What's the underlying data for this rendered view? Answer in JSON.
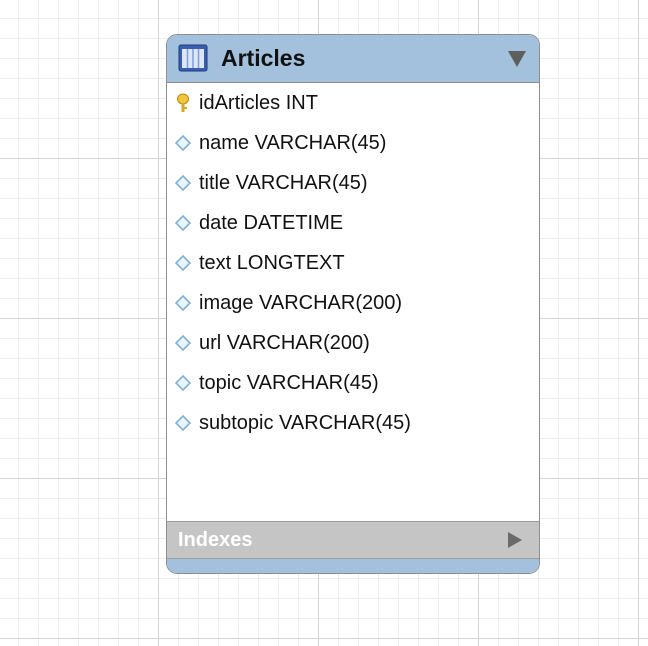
{
  "table": {
    "title": "Articles",
    "columns": [
      {
        "label": "idArticles INT",
        "key": true
      },
      {
        "label": "name VARCHAR(45)",
        "key": false
      },
      {
        "label": "title VARCHAR(45)",
        "key": false
      },
      {
        "label": "date DATETIME",
        "key": false
      },
      {
        "label": "text LONGTEXT",
        "key": false
      },
      {
        "label": "image VARCHAR(200)",
        "key": false
      },
      {
        "label": "url VARCHAR(200)",
        "key": false
      },
      {
        "label": "topic VARCHAR(45)",
        "key": false
      },
      {
        "label": "subtopic VARCHAR(45)",
        "key": false
      }
    ],
    "indexes_label": "Indexes"
  },
  "icons": {
    "table": "table-icon",
    "primary_key": "key-icon",
    "column": "diamond-icon",
    "collapse": "triangle-down-icon",
    "expand": "triangle-right-icon"
  },
  "colors": {
    "header": "#a3c1dc",
    "indexes_bar": "#c5c5c5",
    "key": "#e8b820",
    "diamond": "#7fb0d6"
  }
}
